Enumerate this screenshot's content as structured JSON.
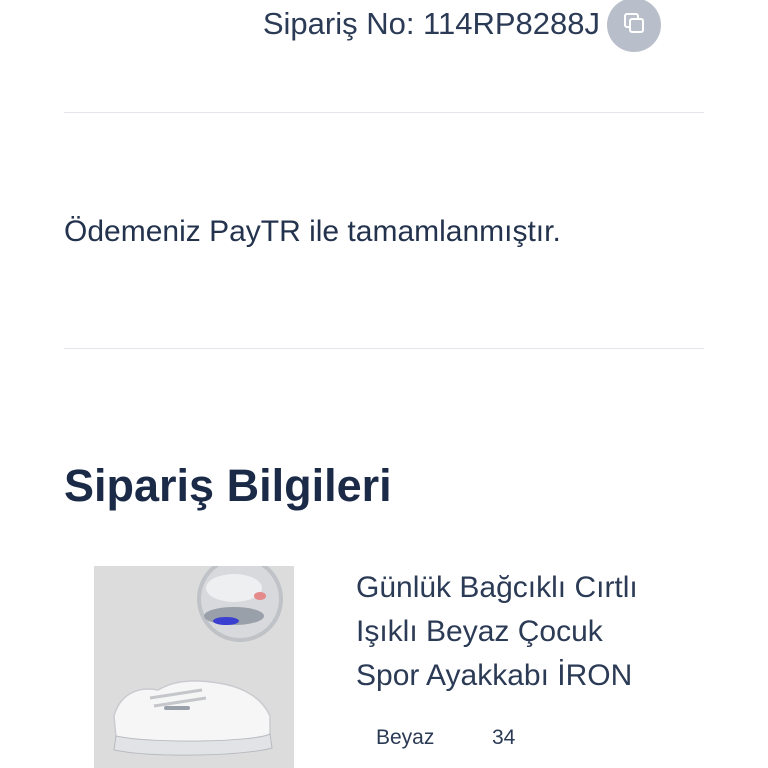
{
  "order": {
    "number_text": "Sipariş No: 114RP8288J",
    "copy_icon": "copy-icon"
  },
  "payment": {
    "message": "Ödemeniz PayTR ile tamamlanmıştır."
  },
  "order_info": {
    "title": "Sipariş Bilgileri",
    "product": {
      "name_lines": [
        "Günlük Bağcıklı Cırtlı",
        "Işıklı Beyaz Çocuk",
        "Spor Ayakkabı İRON"
      ],
      "color": "Beyaz",
      "size": "34",
      "image_icon": "sneaker-product-image"
    }
  },
  "colors": {
    "text_primary": "#1c2b45",
    "divider": "#e3e6eb",
    "copy_button_bg": "#b9bfca",
    "image_bg": "#dcdcdc"
  }
}
